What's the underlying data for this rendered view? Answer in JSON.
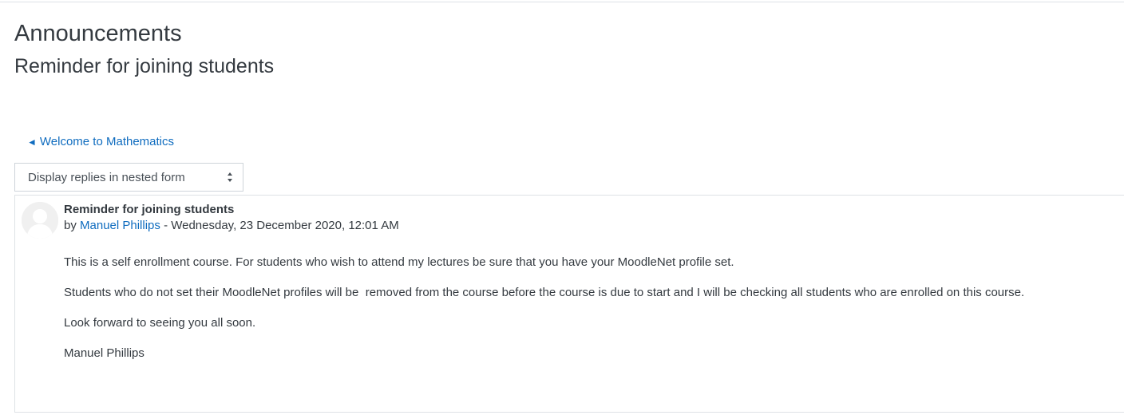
{
  "header": {
    "forum_title": "Announcements",
    "discussion_title": "Reminder for joining students"
  },
  "navigation": {
    "previous_arrow": "◄",
    "previous_link": "Welcome to Mathematics"
  },
  "display_mode": {
    "selected": "Display replies in nested form"
  },
  "post": {
    "subject": "Reminder for joining students",
    "by_label": "by",
    "author": "Manuel Phillips",
    "date_text": " - Wednesday, 23 December 2020, 12:01 AM",
    "avatar_icon": "default-user-avatar-icon",
    "paragraphs": [
      "This is a self enrollment course. For students who wish to attend my lectures be sure that you have your MoodleNet profile set.",
      "Students who do not set their MoodleNet profiles will be  removed from the course before the course is due to start and I will be checking all students who are enrolled on this course.",
      "Look forward to seeing you all soon.",
      "Manuel Phillips"
    ]
  },
  "colors": {
    "link": "#0f6cbf",
    "text": "#343a40",
    "border": "#dee2e6"
  }
}
